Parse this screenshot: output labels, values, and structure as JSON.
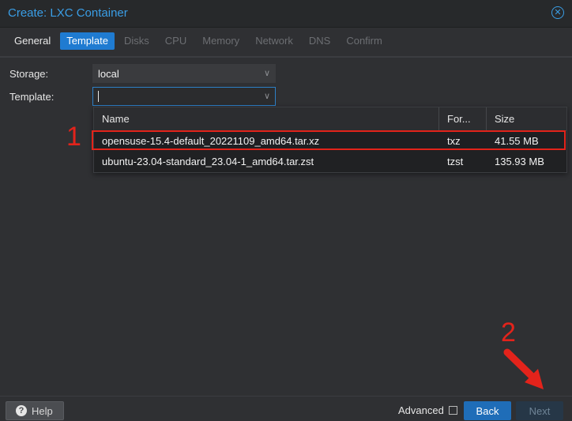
{
  "window": {
    "title": "Create: LXC Container",
    "close_icon": "close-icon"
  },
  "tabs": [
    {
      "label": "General",
      "state": "done"
    },
    {
      "label": "Template",
      "state": "active"
    },
    {
      "label": "Disks",
      "state": "disabled"
    },
    {
      "label": "CPU",
      "state": "disabled"
    },
    {
      "label": "Memory",
      "state": "disabled"
    },
    {
      "label": "Network",
      "state": "disabled"
    },
    {
      "label": "DNS",
      "state": "disabled"
    },
    {
      "label": "Confirm",
      "state": "disabled"
    }
  ],
  "form": {
    "storage_label": "Storage:",
    "storage_value": "local",
    "template_label": "Template:",
    "template_value": ""
  },
  "dropdown": {
    "columns": [
      "Name",
      "For...",
      "Size"
    ],
    "rows": [
      {
        "name": "opensuse-15.4-default_20221109_amd64.tar.xz",
        "format": "txz",
        "size": "41.55 MB"
      },
      {
        "name": "ubuntu-23.04-standard_23.04-1_amd64.tar.zst",
        "format": "tzst",
        "size": "135.93 MB"
      }
    ]
  },
  "annotations": {
    "marker_1": "1",
    "marker_2": "2",
    "color": "#e3231b"
  },
  "footer": {
    "help_label": "Help",
    "advanced_label": "Advanced",
    "advanced_checked": false,
    "back_label": "Back",
    "next_label": "Next"
  },
  "colors": {
    "accent": "#3a9ee6",
    "active_tab": "#1f7bd1",
    "back_button": "#1f6db8",
    "next_button_disabled": "#263747"
  }
}
